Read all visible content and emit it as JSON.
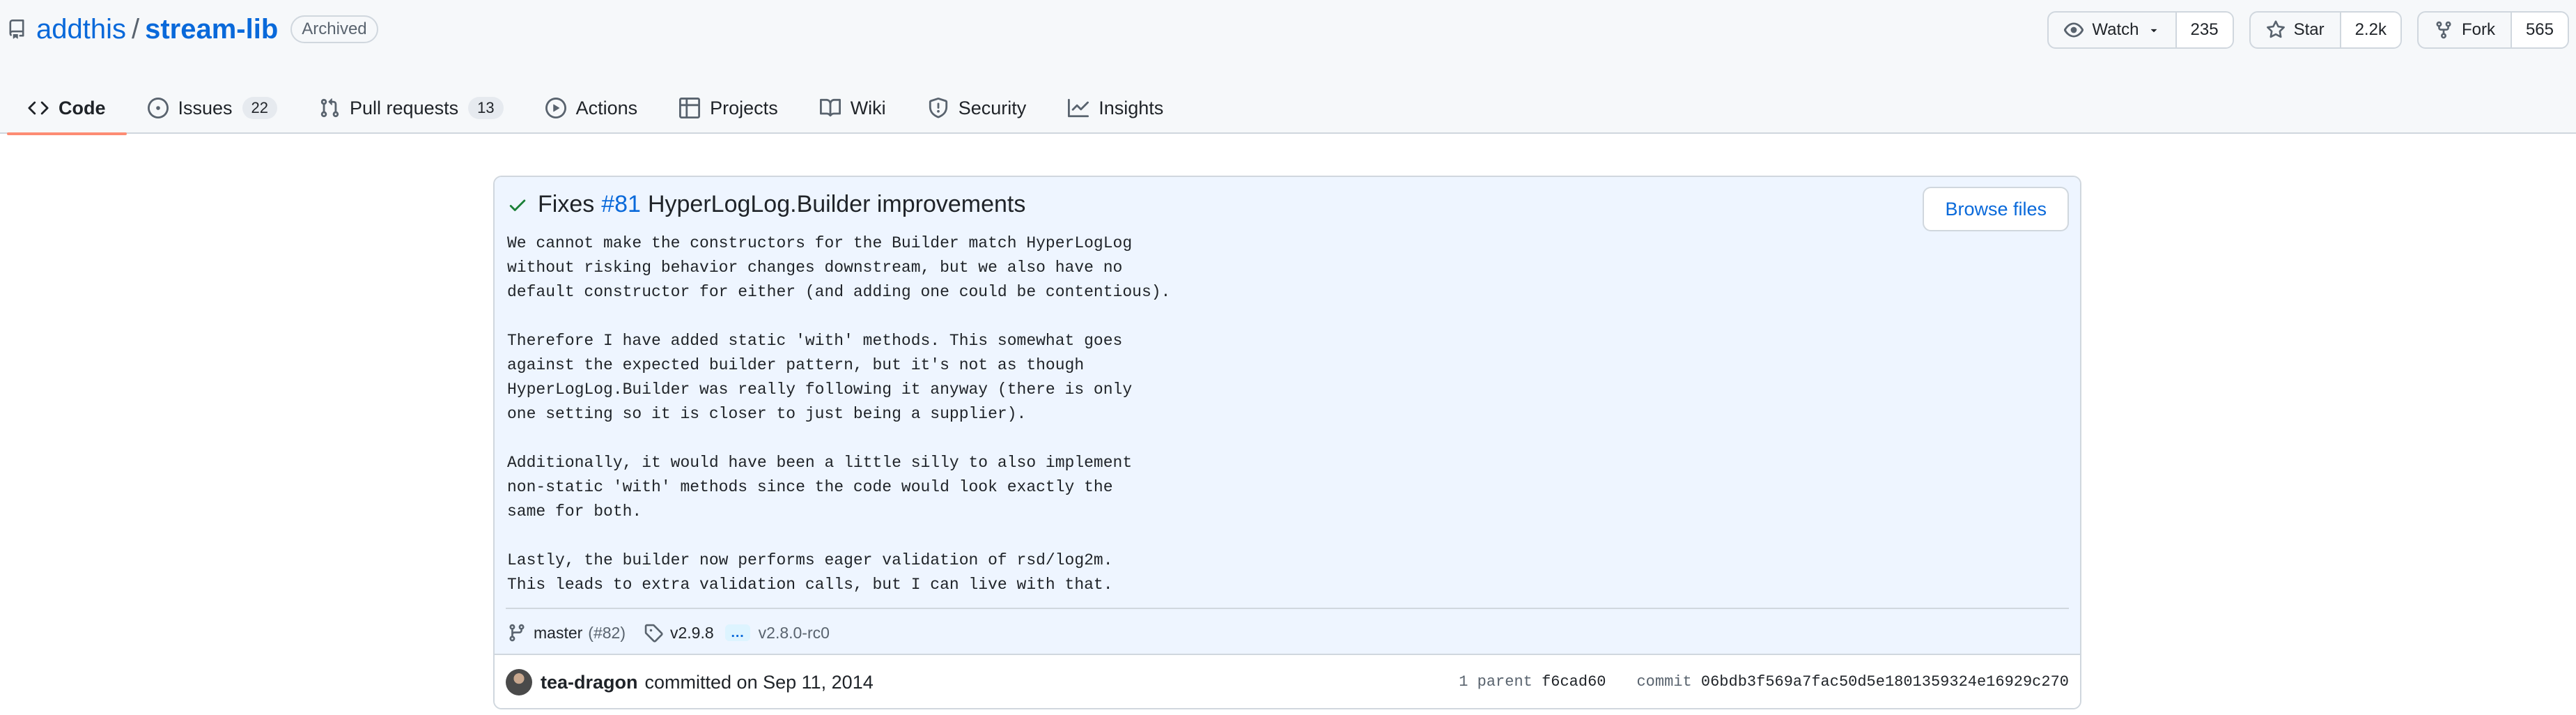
{
  "repo": {
    "owner": "addthis",
    "separator": "/",
    "name": "stream-lib",
    "badge": "Archived"
  },
  "actions": {
    "watch": {
      "label": "Watch",
      "count": "235"
    },
    "star": {
      "label": "Star",
      "count": "2.2k"
    },
    "fork": {
      "label": "Fork",
      "count": "565"
    }
  },
  "tabs": [
    {
      "label": "Code",
      "icon": "code-icon",
      "active": true
    },
    {
      "label": "Issues",
      "icon": "issue-opened-icon",
      "count": "22"
    },
    {
      "label": "Pull requests",
      "icon": "git-pull-request-icon",
      "count": "13"
    },
    {
      "label": "Actions",
      "icon": "play-icon"
    },
    {
      "label": "Projects",
      "icon": "table-icon"
    },
    {
      "label": "Wiki",
      "icon": "book-icon"
    },
    {
      "label": "Security",
      "icon": "shield-icon"
    },
    {
      "label": "Insights",
      "icon": "graph-icon"
    }
  ],
  "commit": {
    "title_prefix": "Fixes",
    "issue_ref": "#81",
    "title_rest": "HyperLogLog.Builder improvements",
    "browse_label": "Browse files",
    "body": "We cannot make the constructors for the Builder match HyperLogLog\nwithout risking behavior changes downstream, but we also have no\ndefault constructor for either (and adding one could be contentious).\n\nTherefore I have added static 'with' methods. This somewhat goes\nagainst the expected builder pattern, but it's not as though\nHyperLogLog.Builder was really following it anyway (there is only\none setting so it is closer to just being a supplier).\n\nAdditionally, it would have been a little silly to also implement\nnon-static 'with' methods since the code would look exactly the\nsame for both.\n\nLastly, the builder now performs eager validation of rsd/log2m.\nThis leads to extra validation calls, but I can live with that.",
    "branch": "master",
    "branch_ref": "(#82)",
    "tag_first": "v2.9.8",
    "tag_ellipsis": "…",
    "tag_last": "v2.8.0-rc0",
    "author": "tea-dragon",
    "committed_text": "committed on Sep 11, 2014",
    "parent_label": "1 parent",
    "parent_hash": "f6cad60",
    "commit_label": "commit",
    "commit_hash": "06bdb3f569a7fac50d5e1801359324e16929c270"
  },
  "colors": {
    "link": "#0969da",
    "tab_underline": "#fd8c73",
    "commit_header_bg": "#eef5ff",
    "check": "#1a7f37"
  }
}
